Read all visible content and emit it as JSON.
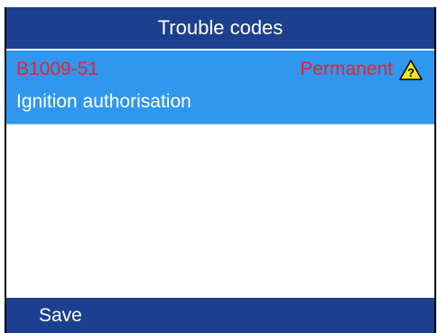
{
  "header": {
    "title": "Trouble codes"
  },
  "dtc_list": [
    {
      "code": "B1009-51",
      "status": "Permanent",
      "description": "Ignition authorisation",
      "icon": "warning-question-icon"
    }
  ],
  "footer": {
    "save_label": "Save"
  },
  "colors": {
    "header_bg": "#1d3f8f",
    "selected_row_bg": "#2f97ee",
    "code_text": "#e8232c",
    "status_text": "#e8232c",
    "icon_fill": "#f5e60f"
  }
}
